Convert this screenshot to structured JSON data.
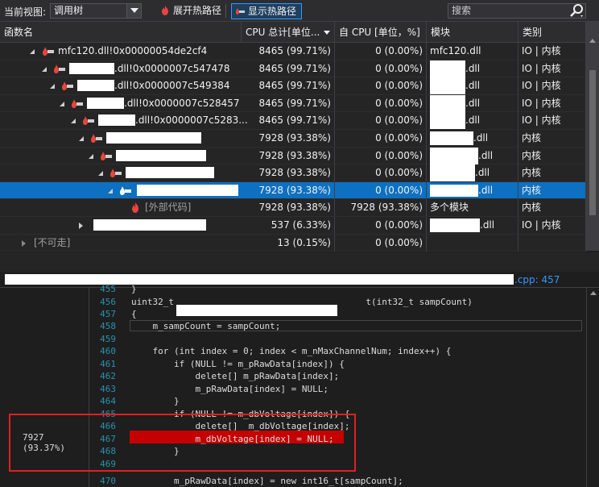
{
  "toolbar": {
    "view_label": "当前视图:",
    "view_value": "调用树",
    "expand_label": "展开热路径",
    "show_label": "显示热路径",
    "search_placeholder": "搜索"
  },
  "columns": [
    "函数名",
    "CPU 总计[单位...",
    "自 CPU [单位，%]",
    "模块",
    "类别"
  ],
  "rows": [
    {
      "name": "mfc120.dll!0x00000054de2cf4",
      "cpu_total": "8465 (99.71%)",
      "self_cpu": "0 (0.00%)",
      "module": "mfc120.dll",
      "category": "IO | 内核"
    },
    {
      "name": ".dll!0x0000007c547478",
      "cpu_total": "8465 (99.71%)",
      "self_cpu": "0 (0.00%)",
      "module": ".dll",
      "category": "IO | 内核"
    },
    {
      "name": ".dll!0x0000007c549384",
      "cpu_total": "8465 (99.71%)",
      "self_cpu": "0 (0.00%)",
      "module": ".dll",
      "category": "IO | 内核"
    },
    {
      "name": ".dll!0x0000007c528457",
      "cpu_total": "8465 (99.71%)",
      "self_cpu": "0 (0.00%)",
      "module": ".dll",
      "category": "IO | 内核"
    },
    {
      "name": ".dll!0x0000007c5283...",
      "cpu_total": "8465 (99.71%)",
      "self_cpu": "0 (0.00%)",
      "module": ".dll",
      "category": "IO | 内核"
    },
    {
      "name": "",
      "cpu_total": "7928 (93.38%)",
      "self_cpu": "0 (0.00%)",
      "module": ".dll",
      "category": "内核"
    },
    {
      "name": "",
      "cpu_total": "7928 (93.38%)",
      "self_cpu": "0 (0.00%)",
      "module": ".dll",
      "category": "内核"
    },
    {
      "name": "",
      "cpu_total": "7928 (93.38%)",
      "self_cpu": "0 (0.00%)",
      "module": ".dll",
      "category": "内核"
    },
    {
      "name": "",
      "cpu_total": "7928 (93.38%)",
      "self_cpu": "0 (0.00%)",
      "module": ".dll",
      "category": "内核"
    },
    {
      "name": "[外部代码]",
      "cpu_total": "7928 (93.38%)",
      "self_cpu": "7928 (93.38%)",
      "module": "多个模块",
      "category": "内核"
    },
    {
      "name": "",
      "cpu_total": "537 (6.33%)",
      "self_cpu": "0 (0.00%)",
      "module": ".dll",
      "category": "IO | 内核"
    },
    {
      "name": "[不可走]",
      "cpu_total": "13 (0.15%)",
      "self_cpu": "0 (0.00%)",
      "module": "",
      "category": ""
    }
  ],
  "source_path_suffix": ".cpp: 457",
  "gutter_value": "7927 (93.37%)",
  "code_lines": [
    {
      "n": "455",
      "text": "}"
    },
    {
      "n": "456",
      "text": "uint32_t                                    t(int32_t sampCount)"
    },
    {
      "n": "457",
      "text": "{"
    },
    {
      "n": "458",
      "text": "    m_sampCount = sampCount;"
    },
    {
      "n": "459",
      "text": ""
    },
    {
      "n": "460",
      "text": "    for (int index = 0; index < m_nMaxChannelNum; index++) {"
    },
    {
      "n": "461",
      "text": "        if (NULL != m_pRawData[index]) {"
    },
    {
      "n": "462",
      "text": "            delete[] m_pRawData[index];"
    },
    {
      "n": "463",
      "text": "            m_pRawData[index] = NULL;"
    },
    {
      "n": "464",
      "text": "        }"
    },
    {
      "n": "465",
      "text": "        if (NULL != m_dbVoltage[index]) {"
    },
    {
      "n": "466",
      "text": "            delete[]  m_dbVoltage[index];"
    },
    {
      "n": "467",
      "text": "            m_dbVoltage[index] = NULL;"
    },
    {
      "n": "468",
      "text": "        }"
    },
    {
      "n": "469",
      "text": ""
    },
    {
      "n": "470",
      "text": "        m_pRawData[index] = new int16_t[sampCount];"
    }
  ]
}
